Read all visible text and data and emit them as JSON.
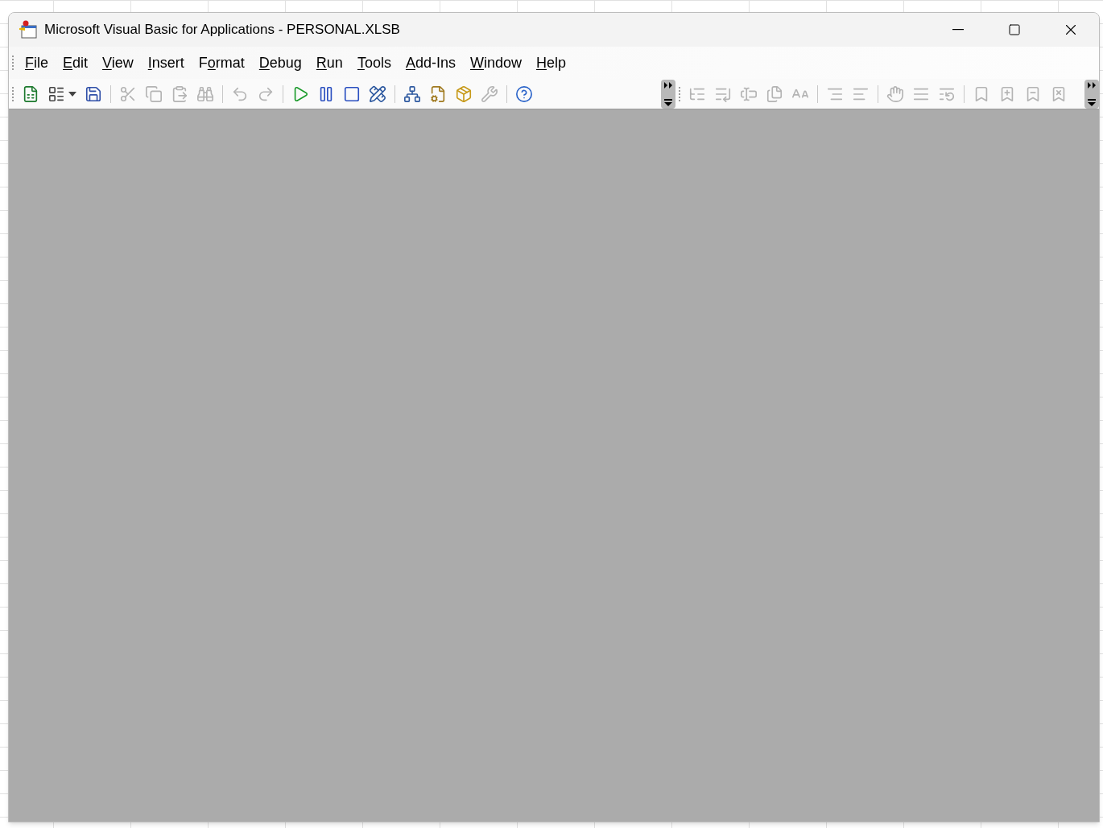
{
  "window": {
    "title": "Microsoft Visual Basic for Applications - PERSONAL.XLSB"
  },
  "menu": [
    {
      "access_key": "F",
      "rest": "ile"
    },
    {
      "access_key": "E",
      "rest": "dit"
    },
    {
      "access_key": "V",
      "rest": "iew"
    },
    {
      "access_key": "I",
      "rest": "nsert"
    },
    {
      "before": "F",
      "access_key": "o",
      "rest": "rmat"
    },
    {
      "access_key": "D",
      "rest": "ebug"
    },
    {
      "access_key": "R",
      "rest": "un"
    },
    {
      "access_key": "T",
      "rest": "ools"
    },
    {
      "access_key": "A",
      "rest": "dd-Ins"
    },
    {
      "access_key": "W",
      "rest": "indow"
    },
    {
      "access_key": "H",
      "rest": "elp"
    }
  ],
  "toolbars": [
    {
      "items": [
        {
          "kind": "button",
          "disabled": false
        },
        {
          "kind": "dropdown",
          "disabled": false
        },
        {
          "kind": "button",
          "disabled": false
        },
        {
          "kind": "separator"
        },
        {
          "kind": "button",
          "disabled": true
        },
        {
          "kind": "button",
          "disabled": true
        },
        {
          "kind": "button",
          "disabled": true
        },
        {
          "kind": "button",
          "disabled": true
        },
        {
          "kind": "separator"
        },
        {
          "kind": "button",
          "disabled": true
        },
        {
          "kind": "button",
          "disabled": true
        },
        {
          "kind": "separator"
        },
        {
          "kind": "button",
          "disabled": false
        },
        {
          "kind": "button",
          "disabled": false
        },
        {
          "kind": "button",
          "disabled": false
        },
        {
          "kind": "button",
          "disabled": false
        },
        {
          "kind": "separator"
        },
        {
          "kind": "button",
          "disabled": false
        },
        {
          "kind": "button",
          "disabled": false
        },
        {
          "kind": "button",
          "disabled": false
        },
        {
          "kind": "button",
          "disabled": true
        },
        {
          "kind": "separator"
        },
        {
          "kind": "button",
          "disabled": false
        }
      ]
    },
    {
      "items": [
        {
          "kind": "button",
          "disabled": true
        },
        {
          "kind": "button",
          "disabled": true
        },
        {
          "kind": "button",
          "disabled": true
        },
        {
          "kind": "button",
          "disabled": true
        },
        {
          "kind": "button",
          "disabled": true
        },
        {
          "kind": "separator"
        },
        {
          "kind": "button",
          "disabled": true
        },
        {
          "kind": "button",
          "disabled": true
        },
        {
          "kind": "separator"
        },
        {
          "kind": "button",
          "disabled": true
        },
        {
          "kind": "button",
          "disabled": true
        },
        {
          "kind": "button",
          "disabled": true
        },
        {
          "kind": "separator"
        },
        {
          "kind": "button",
          "disabled": true
        },
        {
          "kind": "button",
          "disabled": true
        },
        {
          "kind": "button",
          "disabled": true
        },
        {
          "kind": "button",
          "disabled": true
        }
      ]
    }
  ]
}
